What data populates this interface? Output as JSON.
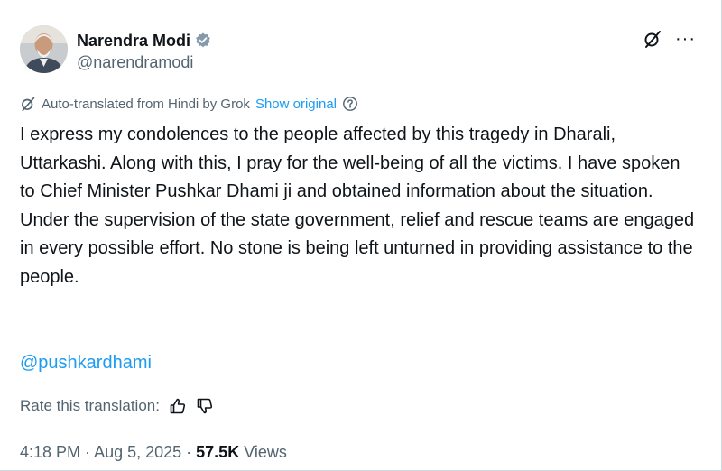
{
  "author": {
    "display_name": "Narendra Modi",
    "handle": "@narendramodi",
    "verified_icon": "verified-badge-icon"
  },
  "actions": {
    "grok_icon": "grok-icon",
    "more_icon": "more-icon",
    "more_label": "···"
  },
  "translation": {
    "notice": "Auto-translated from Hindi by Grok",
    "show_original": "Show original",
    "help_icon": "help-icon"
  },
  "post": {
    "text": "I express my condolences to the people affected by this tragedy in Dharali, Uttarkashi. Along with this, I pray for the well-being of all the victims. I have spoken to Chief Minister Pushkar Dhami ji and obtained information about the situation. Under the supervision of the state government, relief and rescue teams are engaged in every possible effort. No stone is being left unturned in providing assistance to the people.",
    "mention": "@pushkardhami"
  },
  "rating": {
    "label": "Rate this translation:",
    "thumbs_up_icon": "thumbs-up-icon",
    "thumbs_down_icon": "thumbs-down-icon"
  },
  "meta": {
    "time": "4:18 PM",
    "separator": " · ",
    "date": "Aug 5, 2025",
    "views_count": "57.5K",
    "views_label": "Views"
  },
  "colors": {
    "accent": "#1d9bf0",
    "text": "#0f1419",
    "secondary": "#536471"
  }
}
